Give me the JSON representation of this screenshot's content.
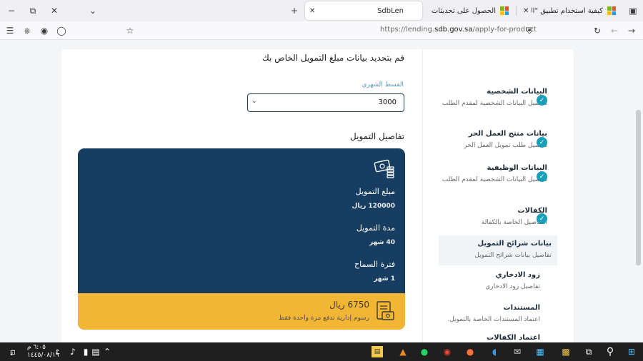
{
  "browser": {
    "tabs": [
      {
        "title": "كيفية استخدام تطبيق \"التحقق من",
        "active": false
      },
      {
        "title": "الحصول على تحديثات Windows",
        "active": false
      },
      {
        "title": "SdbLen",
        "active": true
      }
    ],
    "url_prefix": "https://lending.",
    "url_domain": "sdb.gov.sa",
    "url_path": "/apply-for-product"
  },
  "form": {
    "heading": "قم بتحديد بيانات مبلغ التمويل الخاص بك",
    "installment_label": "القسط الشهري",
    "installment_value": "3000",
    "details_heading": "تفاصيل التمويل"
  },
  "finance": {
    "amount_label": "مبلغ التمويل",
    "amount_value": "120000 ريال",
    "duration_label": "مدة التمويل",
    "duration_value": "40 شهر",
    "grace_label": "فترة السماح",
    "grace_value": "1 شهر",
    "fee_amount": "6750 ريال",
    "fee_note": "رسوم إدارية تدفع مرة واحدة فقط"
  },
  "steps": [
    {
      "title": "البيانات الشخصية",
      "desc": "تفاصيل البيانات الشخصية لمقدم الطلب",
      "done": true
    },
    {
      "title": "بيانات منتج العمل الحر",
      "desc": "تفاصيل طلب تمويل العمل الحر",
      "done": true
    },
    {
      "title": "البيانات الوظيفية",
      "desc": "تفاصيل البيانات الشخصية لمقدم الطلب",
      "done": true
    },
    {
      "title": "الكفالات",
      "desc": "التفاصيل الخاصة بالكفالة",
      "done": true
    },
    {
      "title": "بيانات شرائح التمويل",
      "desc": "تفاصيل بيانات شرائح التمويل",
      "done": false,
      "active": true
    },
    {
      "title": "زود الادخاري",
      "desc": "تفاصيل زود الادخاري",
      "done": false
    },
    {
      "title": "المستندات",
      "desc": "اعتماد المستندات الخاصة بالتمويل.",
      "done": false
    },
    {
      "title": "اعتماد الكفالات",
      "desc": "",
      "done": false
    }
  ],
  "taskbar": {
    "time": "٦:٠٥ م",
    "date": "١٤٤٥/٠٨/١٩",
    "lang": "ع",
    "notification_count": "2"
  },
  "colors": {
    "finance_card": "#173e61",
    "fee_bar": "#f2b534",
    "check": "#1a9fb9",
    "select_border": "#1b4168"
  }
}
